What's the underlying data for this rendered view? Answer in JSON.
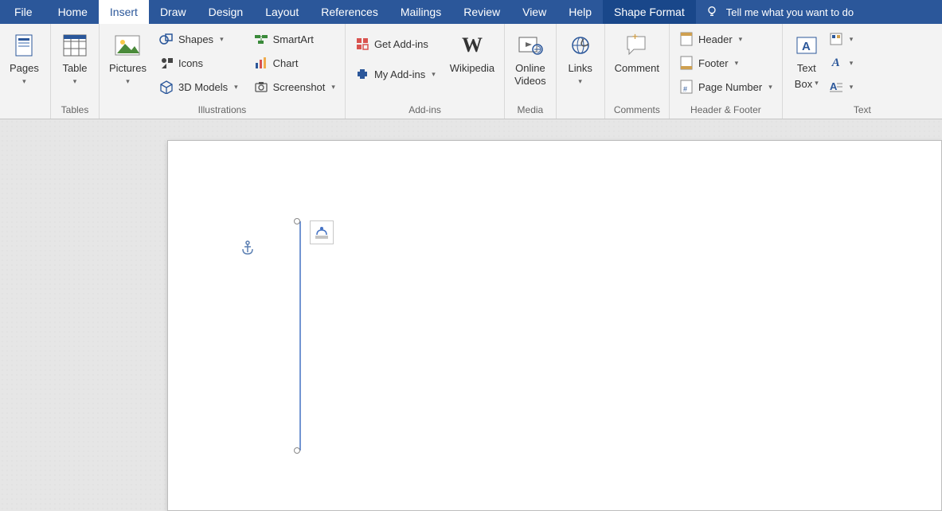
{
  "tabs": {
    "file": "File",
    "home": "Home",
    "insert": "Insert",
    "draw": "Draw",
    "design": "Design",
    "layout": "Layout",
    "references": "References",
    "mailings": "Mailings",
    "review": "Review",
    "view": "View",
    "help": "Help",
    "shape_format": "Shape Format",
    "tell_me": "Tell me what you want to do"
  },
  "groups": {
    "pages": "",
    "tables": "Tables",
    "illustrations": "Illustrations",
    "addins": "Add-ins",
    "media": "Media",
    "links": "",
    "comments": "Comments",
    "header_footer": "Header & Footer",
    "text": "Text"
  },
  "cmd": {
    "pages": "Pages",
    "table": "Table",
    "pictures": "Pictures",
    "shapes": "Shapes",
    "icons": "Icons",
    "models": "3D Models",
    "smartart": "SmartArt",
    "chart": "Chart",
    "screenshot": "Screenshot",
    "get_addins": "Get Add-ins",
    "my_addins": "My Add-ins",
    "wikipedia": "Wikipedia",
    "online_videos_l1": "Online",
    "online_videos_l2": "Videos",
    "links": "Links",
    "comment": "Comment",
    "header": "Header",
    "footer": "Footer",
    "page_number": "Page Number",
    "text_box_l1": "Text",
    "text_box_l2": "Box"
  }
}
